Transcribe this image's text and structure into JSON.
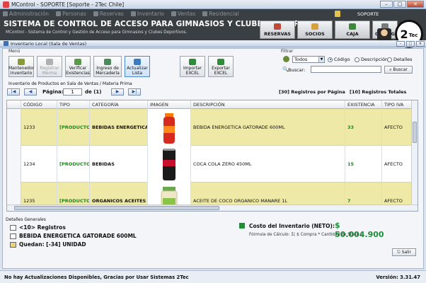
{
  "window": {
    "title": "MControl - SOPORTE [Soporte - 2Tec Chile]"
  },
  "header": {
    "menu": [
      {
        "label": "Administración",
        "icon": "gear-icon"
      },
      {
        "label": "Personas",
        "icon": "person-icon"
      },
      {
        "label": "Reservas",
        "icon": "calendar-icon"
      },
      {
        "label": "Inventario",
        "icon": "box-icon"
      },
      {
        "label": "Ventas",
        "icon": "cart-icon"
      },
      {
        "label": "Residencial",
        "icon": "house-icon"
      }
    ],
    "user": "SOPORTE",
    "title": "SISTEMA DE CONTROL DE ACCESO PARA GIMNASIOS Y CLUBES DEPORTIVO",
    "subtitle": "MControl - Sistema de Control y Gestión de Acceso para Gimnasios y Clubes Deportivos.",
    "buttons": [
      "RESERVAS",
      "SOCIOS",
      "CAJA",
      "CONFIG"
    ],
    "logo": "2",
    "logo_sub": "Tec"
  },
  "subwindow": {
    "title": "Inventario Local (Sala de Ventas)"
  },
  "menu_group": {
    "label": "Menú",
    "buttons": [
      {
        "label": "Mantenedor Inventario",
        "state": "normal",
        "color": "#8a9a3a"
      },
      {
        "label": "Registrar Merma",
        "state": "disabled",
        "color": "#b0b0b0"
      },
      {
        "label": "Verificar Existencias",
        "state": "normal",
        "color": "#5a9a4a"
      },
      {
        "label": "Ingreso de Mercadería",
        "state": "normal",
        "color": "#4a8a5a"
      },
      {
        "label": "Actualizar Lista",
        "state": "active",
        "color": "#3a7ac0"
      },
      {
        "label": "Importar EXCEL",
        "state": "normal",
        "color": "#2e8b3a"
      },
      {
        "label": "Exportar EXCEL",
        "state": "normal",
        "color": "#2e8b3a"
      }
    ]
  },
  "filter": {
    "label": "Filtrar",
    "combo_value": "Todos",
    "options": [
      "Código",
      "Descripción",
      "Detalles"
    ],
    "selected": "Código",
    "search_label": "Buscar:",
    "search_value": "",
    "search_button": "Buscar"
  },
  "inventory_label": "Inventario de Productos en Sala de Ventas / Materia Prima",
  "pager": {
    "first": "|◀",
    "prev": "◀",
    "next": "▶",
    "last": "▶|",
    "page_label": "Página:",
    "page": "1",
    "of_label": "de (1)",
    "per_page": "[30] Registros por Página",
    "total": "[10] Registros Totales"
  },
  "grid": {
    "columns": [
      "CÓDIGO",
      "TIPO",
      "CATEGORÍA",
      "IMAGEN",
      "DESCRIPCIÓN",
      "EXISTENCIA",
      "TIPO IVA"
    ],
    "rows": [
      {
        "codigo": "1233",
        "tipo": "[PRODUCTO]",
        "categoria": "BEBIDAS ENERGETICAS",
        "descripcion": "BEBIDA ENERGETICA GATORADE 600ML",
        "existencia": "33",
        "iva": "AFECTO",
        "alt": true,
        "bottle": "#d62a1e"
      },
      {
        "codigo": "1234",
        "tipo": "[PRODUCTO]",
        "categoria": "BEBIDAS",
        "descripcion": "COCA COLA ZERO 450ML",
        "existencia": "15",
        "iva": "AFECTO",
        "alt": false,
        "bottle": "#1a1a1a"
      },
      {
        "codigo": "1235",
        "tipo": "[PRODUCTO]",
        "categoria": "ORGANICOS ACEITES",
        "descripcion": "ACEITE DE COCO ORGANICO MANARE 1L",
        "existencia": "7",
        "iva": "AFECTO",
        "alt": true,
        "bottle": "#e8e2c0"
      }
    ]
  },
  "details": {
    "label": "Detalles Generales",
    "records": "<10> Registros",
    "product": "BEBIDA ENERGETICA GATORADE 600ML",
    "remaining": "Quedan: [-34] UNIDAD",
    "cost_label": "Costo del Inventario (NETO):",
    "cost_value": "$ 50.004.900",
    "formula": "Fórmula de Cálculo: Σ( $ Compra * Cantidad de Stock )",
    "exit": "Salir"
  },
  "status": {
    "message": "No hay Actualizaciones Disponibles, Gracias por Usar Sistemas 2Tec",
    "version": "Versión:   3.31.47"
  }
}
